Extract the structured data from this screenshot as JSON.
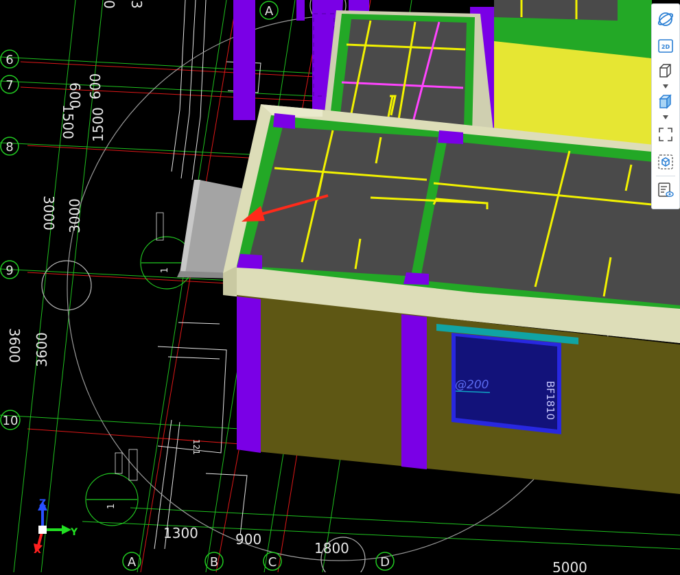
{
  "grid": {
    "rows": [
      "6",
      "7",
      "8",
      "9",
      "10"
    ],
    "cols": [
      "A",
      "A",
      "B",
      "C",
      "D"
    ]
  },
  "dims": {
    "left": [
      "600",
      "600",
      "1500",
      "1500",
      "3000",
      "3000",
      "3600",
      "3600"
    ],
    "bottom": [
      "1300",
      "900",
      "1800",
      "5000"
    ],
    "top": [
      "3",
      "0"
    ]
  },
  "drawing_labels": {
    "window_label_1": "@200",
    "window_label_2": "BF1810",
    "section_1": "1",
    "section_2": "1",
    "small_vertical": "121"
  },
  "axes": {
    "z": "Z",
    "y": "Y",
    "x": "X"
  },
  "toolbar": {
    "buttons": [
      "dynamic-observe",
      "2D",
      "3D-view",
      "3D-box",
      "zoom-extents",
      "component-view",
      "display-settings"
    ],
    "label_2d": "2D"
  },
  "colors": {
    "background": "#000000",
    "column": "#7a00e6",
    "slab": "#4a4a4a",
    "beam": "#23a826",
    "rebar": "#f2f200",
    "wall": "#5e5714",
    "parapet": "#ddddb8",
    "window": "#12127a",
    "arrow": "#ff2a1a"
  }
}
